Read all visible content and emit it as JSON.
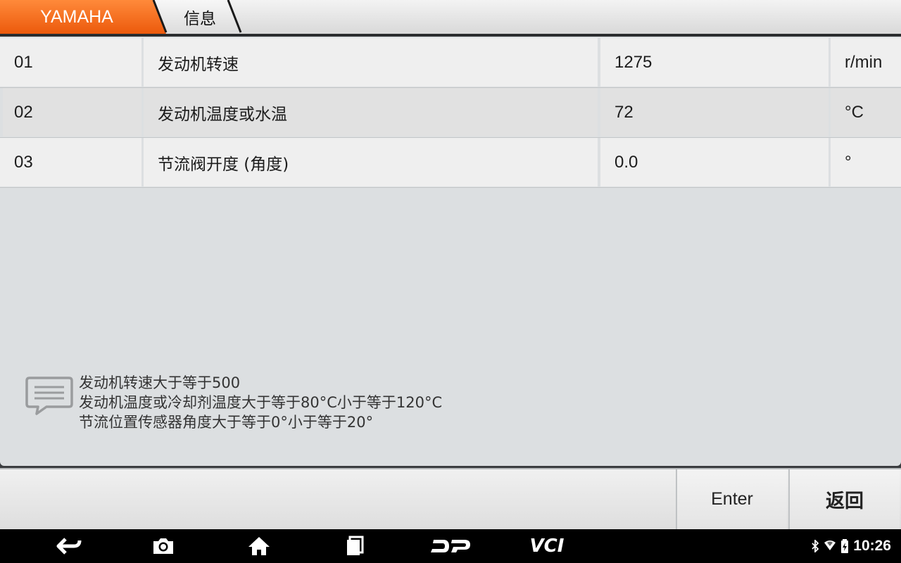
{
  "breadcrumb": {
    "brand": "YAMAHA",
    "current": "信息"
  },
  "table": {
    "rows": [
      {
        "no": "01",
        "name": "发动机转速",
        "value": "1275",
        "unit": "r/min"
      },
      {
        "no": "02",
        "name": "发动机温度或水温",
        "value": "72",
        "unit": "°C"
      },
      {
        "no": "03",
        "name": "节流阀开度 (角度)",
        "value": "0.0",
        "unit": "°"
      }
    ]
  },
  "message": {
    "lines": [
      "发动机转速大于等于500",
      "发动机温度或冷却剂温度大于等于80°C小于等于120°C",
      "节流位置传感器角度大于等于0°小于等于20°"
    ]
  },
  "actions": {
    "enter": "Enter",
    "back": "返回"
  },
  "navbar": {
    "dp_label": "DP",
    "vci_label": "VCI",
    "time": "10:26"
  },
  "colors": {
    "brand_orange": "#f26a1b",
    "panel": "#dcdfe1"
  }
}
